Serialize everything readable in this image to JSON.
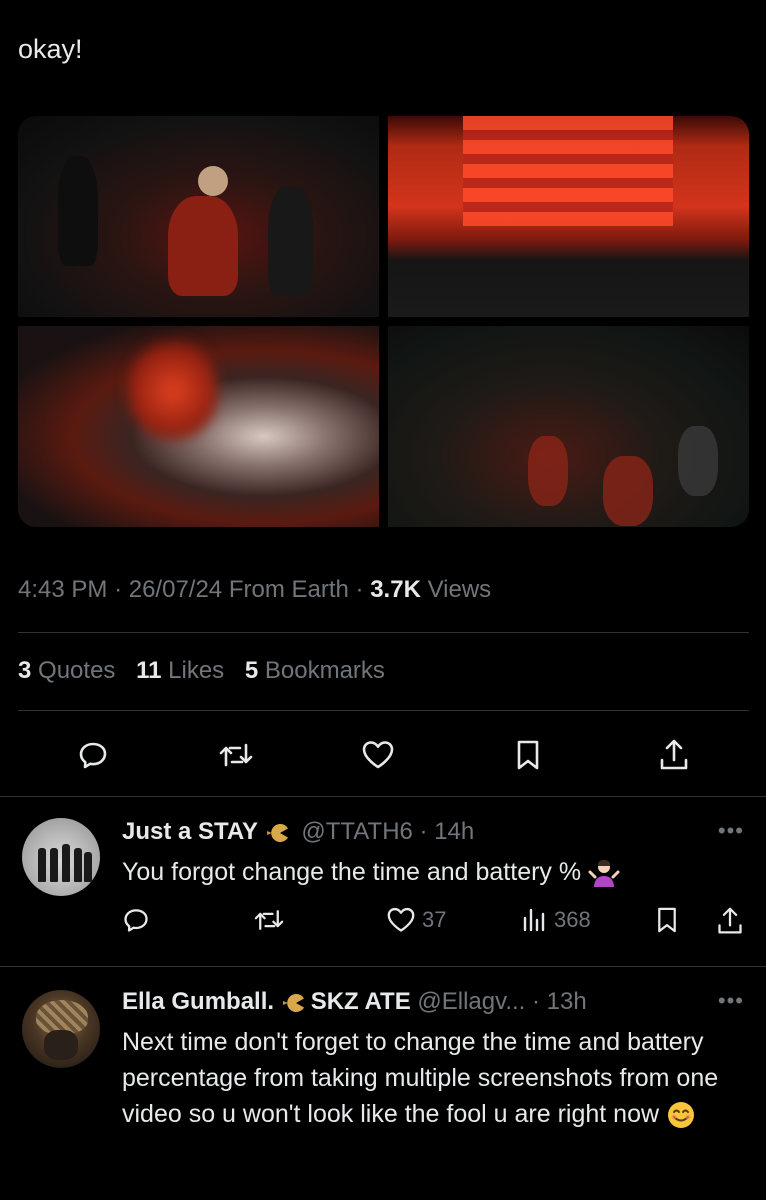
{
  "tweet": {
    "text": "okay!",
    "time": "4:43 PM",
    "date": "26/07/24",
    "source": "From Earth",
    "views_count": "3.7K",
    "views_label": "Views",
    "quotes_count": "3",
    "quotes_label": "Quotes",
    "likes_count": "11",
    "likes_label": "Likes",
    "bookmarks_count": "5",
    "bookmarks_label": "Bookmarks"
  },
  "actions": [
    "reply-icon",
    "retweet-icon",
    "heart-icon",
    "bookmark-icon",
    "share-icon"
  ],
  "replies": [
    {
      "name": "Just a STAY",
      "handle": "@TTATH6",
      "time": "14h",
      "text": "You forgot change the time and battery %",
      "likes": "37",
      "views": "368"
    },
    {
      "name": "Ella Gumball.",
      "name_suffix": "SKZ ATE",
      "handle": "@Ellagv...",
      "time": "13h",
      "text": "Next time don't forget to change the time and battery percentage from taking multiple screenshots from one video so u won't look like the fool u are right now"
    }
  ],
  "colors": {
    "background": "#000000",
    "text": "#e7e9ea",
    "muted": "#71767b",
    "divider": "#2f3336"
  }
}
